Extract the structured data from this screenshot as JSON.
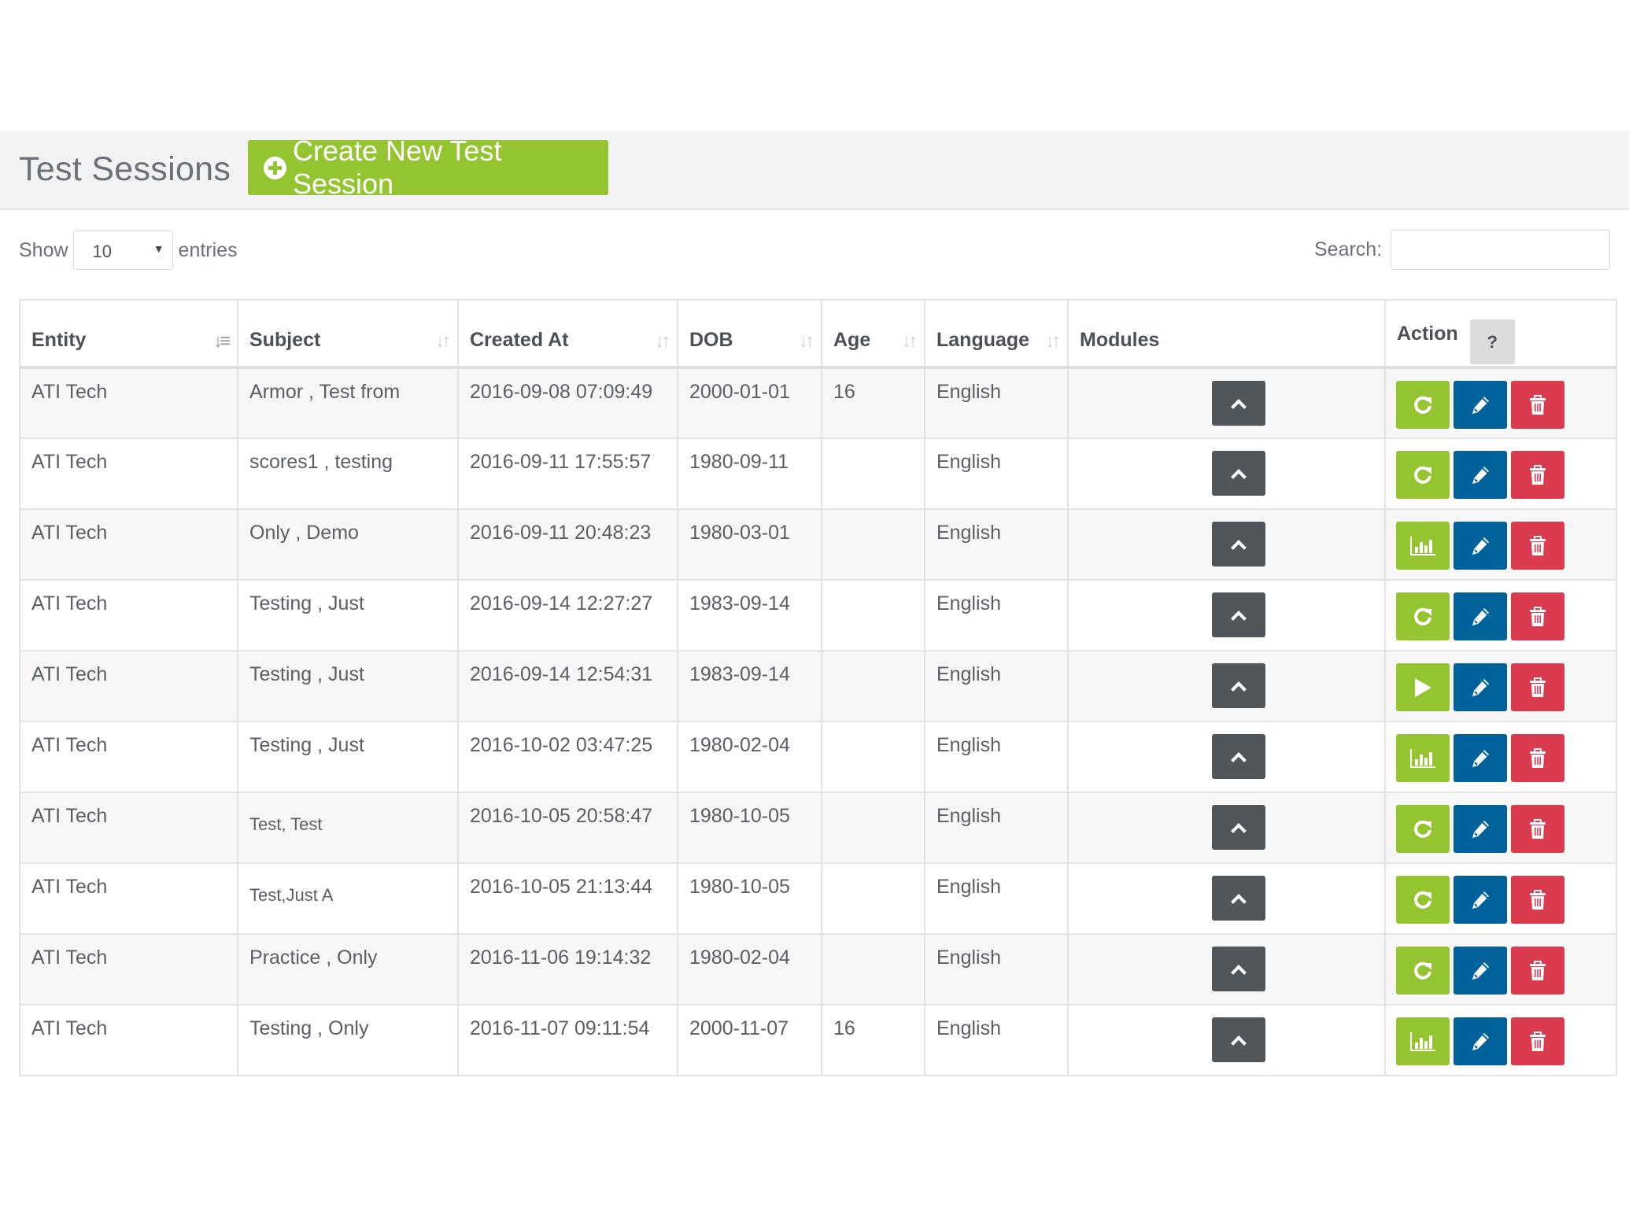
{
  "header": {
    "title": "Test Sessions",
    "create_button": "Create New Test Session"
  },
  "length_control": {
    "prefix": "Show",
    "selected": "10",
    "suffix": "entries"
  },
  "search": {
    "label": "Search:",
    "value": "",
    "placeholder": ""
  },
  "table": {
    "columns": {
      "entity": "Entity",
      "subject": "Subject",
      "created_at": "Created At",
      "dob": "DOB",
      "age": "Age",
      "language": "Language",
      "modules": "Modules",
      "action": "Action",
      "help": "?"
    },
    "sorted_column": "entity",
    "rows": [
      {
        "entity": "ATI Tech",
        "subject": "Armor , Test from",
        "created_at": "2016-09-08 07:09:49",
        "dob": "2000-01-01",
        "age": "16",
        "language": "English",
        "primary_action": "redo-icon"
      },
      {
        "entity": "ATI Tech",
        "subject": "scores1 , testing",
        "created_at": "2016-09-11 17:55:57",
        "dob": "1980-09-11",
        "age": "",
        "language": "English",
        "primary_action": "redo-icon"
      },
      {
        "entity": "ATI Tech",
        "subject": "Only , Demo",
        "created_at": "2016-09-11 20:48:23",
        "dob": "1980-03-01",
        "age": "",
        "language": "English",
        "primary_action": "bar-chart-icon"
      },
      {
        "entity": "ATI Tech",
        "subject": "Testing , Just",
        "created_at": "2016-09-14 12:27:27",
        "dob": "1983-09-14",
        "age": "",
        "language": "English",
        "primary_action": "redo-icon"
      },
      {
        "entity": "ATI Tech",
        "subject": "Testing , Just",
        "created_at": "2016-09-14 12:54:31",
        "dob": "1983-09-14",
        "age": "",
        "language": "English",
        "primary_action": "play-icon"
      },
      {
        "entity": "ATI Tech",
        "subject": "Testing , Just",
        "created_at": "2016-10-02 03:47:25",
        "dob": "1980-02-04",
        "age": "",
        "language": "English",
        "primary_action": "bar-chart-icon"
      },
      {
        "entity": "ATI Tech",
        "subject": "Test, Test",
        "created_at": "2016-10-05 20:58:47",
        "dob": "1980-10-05",
        "age": "",
        "language": "English",
        "primary_action": "redo-icon",
        "subject_small": true
      },
      {
        "entity": "ATI Tech",
        "subject": "Test,Just A",
        "created_at": "2016-10-05 21:13:44",
        "dob": "1980-10-05",
        "age": "",
        "language": "English",
        "primary_action": "redo-icon",
        "subject_small": true
      },
      {
        "entity": "ATI Tech",
        "subject": "Practice , Only",
        "created_at": "2016-11-06 19:14:32",
        "dob": "1980-02-04",
        "age": "",
        "language": "English",
        "primary_action": "redo-icon"
      },
      {
        "entity": "ATI Tech",
        "subject": "Testing , Only",
        "created_at": "2016-11-07 09:11:54",
        "dob": "2000-11-07",
        "age": "16",
        "language": "English",
        "primary_action": "bar-chart-icon"
      }
    ]
  },
  "colors": {
    "primary_green": "#94c531",
    "edit_blue": "#00629a",
    "delete_red": "#db3b4f",
    "module_dark": "#505659",
    "header_bg": "#f3f3f3"
  }
}
